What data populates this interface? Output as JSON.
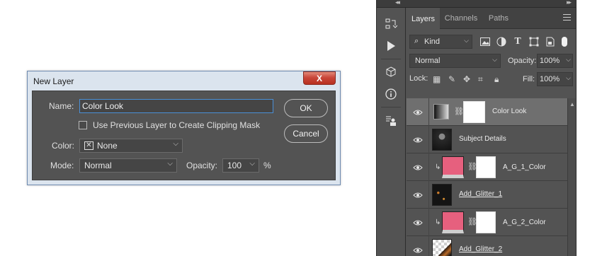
{
  "dialog": {
    "title": "New Layer",
    "close_label": "X",
    "name_label": "Name:",
    "name_value": "Color Look",
    "ok_label": "OK",
    "cancel_label": "Cancel",
    "clipping_label": "Use Previous Layer to Create Clipping Mask",
    "color_label": "Color:",
    "color_value": "None",
    "mode_label": "Mode:",
    "mode_value": "Normal",
    "opacity_label": "Opacity:",
    "opacity_value": "100",
    "opacity_unit": "%"
  },
  "panel": {
    "tabs": [
      {
        "label": "Layers"
      },
      {
        "label": "Channels"
      },
      {
        "label": "Paths"
      }
    ],
    "filter_label": "Kind",
    "blend_mode": "Normal",
    "opacity_label": "Opacity:",
    "opacity_value": "100%",
    "lock_label": "Lock:",
    "fill_label": "Fill:",
    "fill_value": "100%"
  },
  "layers": [
    {
      "name": "Color Look"
    },
    {
      "name": "Subject Details"
    },
    {
      "name": "A_G_1_Color"
    },
    {
      "name": "Add_Glitter_1"
    },
    {
      "name": "A_G_2_Color"
    },
    {
      "name": "Add_Glitter_2"
    }
  ],
  "colors": {
    "swatch_pink": "#e6607e",
    "panel_bg": "#535353",
    "selected_layer": "#6f6f6f",
    "dialog_border": "#6f8bb0"
  }
}
